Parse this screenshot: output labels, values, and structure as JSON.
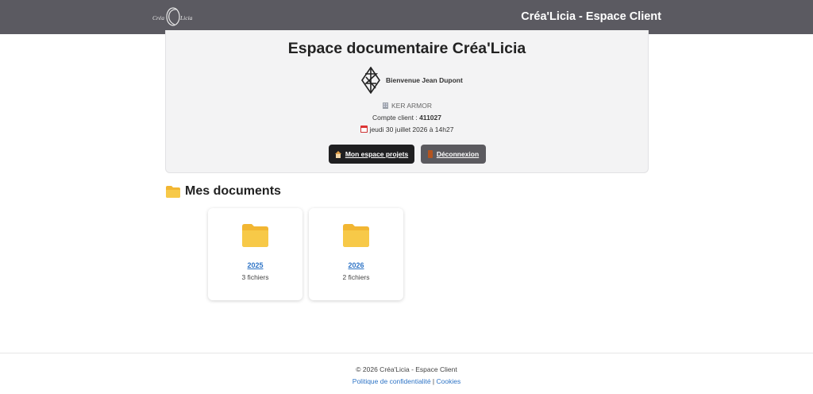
{
  "header": {
    "logo_alt": "Créa'Licia",
    "title": "Créa'Licia - Espace Client"
  },
  "hero": {
    "title": "Espace documentaire Créa'Licia",
    "welcome": "Bienvenue Jean Dupont",
    "company": "KER ARMOR",
    "account_label": "Compte client : ",
    "account_number": "411027",
    "datetime": "jeudi 30 juillet 2026 à 14h27",
    "buttons": {
      "projects": "Mon espace projets",
      "logout": "Déconnexion"
    }
  },
  "documents": {
    "heading": "Mes documents",
    "folders": [
      {
        "year": "2025",
        "count": "3 fichiers"
      },
      {
        "year": "2026",
        "count": "2 fichiers"
      }
    ]
  },
  "footer": {
    "copyright": "© 2026 Créa'Licia - Espace Client",
    "privacy": "Politique de confidentialité",
    "separator": " | ",
    "cookies": "Cookies"
  },
  "colors": {
    "topbar": "#5b5a61",
    "link": "#2e74c6",
    "folder": "#f7c948"
  },
  "icons": [
    "logo",
    "geometric-logo-icon",
    "building-icon",
    "calendar-icon",
    "house-icon",
    "door-icon",
    "folder-icon"
  ]
}
